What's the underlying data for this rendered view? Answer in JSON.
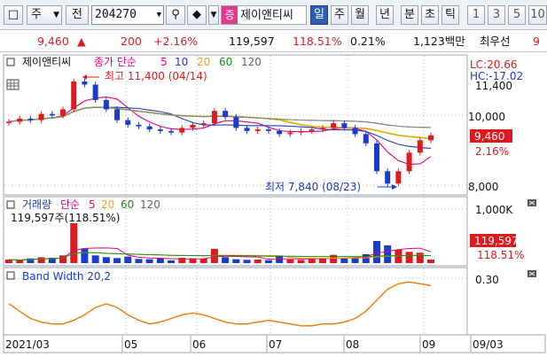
{
  "toolbar": {
    "market": "주",
    "jeon": "전",
    "code": "204270",
    "stock_badge": "증",
    "stock_name": "제이앤티씨",
    "periods": [
      "일",
      "주",
      "월",
      "년",
      "분",
      "초",
      "틱"
    ],
    "active_period": "일",
    "numbers": [
      "1",
      "3",
      "5",
      "10"
    ]
  },
  "quote": {
    "price": "9,460",
    "change_arrow": "▲",
    "change": "200",
    "change_pct": "+2.16%",
    "volume": "119,597",
    "vol_ratio": "118.51%",
    "turnover": "0.21%",
    "amount": "1,123백만",
    "pref_label": "최우선",
    "pref_value": "9"
  },
  "legend": {
    "name": "제이앤티씨",
    "ma_title": "종가 단순",
    "periods": [
      "5",
      "10",
      "20",
      "60",
      "120"
    ],
    "ma_colors": [
      "#e6007e",
      "#1a3bcc",
      "#e6a800",
      "#1b8a1b",
      "#8a8a8a"
    ]
  },
  "volume_legend": {
    "title": "거래량",
    "ma_title": "단순",
    "periods": [
      "5",
      "20",
      "60",
      "120"
    ],
    "value_line": "119,597주(118.51%)"
  },
  "bw_legend": {
    "title": "Band Width 20,2"
  },
  "annotations": {
    "high": "최고 11,400 (04/14)",
    "low": "최저 7,840 (08/23)",
    "lc": "LC:20.66",
    "hc": "HC:-17.02",
    "hc_cut": "11,400"
  },
  "price_axis": {
    "ticks": [
      "10,000",
      "8,000"
    ]
  },
  "current_box": {
    "price": "9,460",
    "pct": "2.16%"
  },
  "volume_axis": {
    "ticks": [
      "1,000K"
    ],
    "current": "119,597",
    "ratio": "118.51%"
  },
  "bw_axis": {
    "ticks": [
      "0.30"
    ]
  },
  "x_axis": {
    "labels": [
      "2021/03",
      "05",
      "06",
      "07",
      "08",
      "09",
      "09/03"
    ]
  },
  "colors": {
    "up": "#e0191e",
    "down": "#1a3bcc",
    "accent": "#2c5fb8"
  },
  "chart_data": [
    {
      "type": "line",
      "title": "",
      "xlabel": "",
      "ylabel": "",
      "series": [
        {
          "name": "종가",
          "values": [
            9900,
            10000,
            9950,
            10150,
            10100,
            10300,
            11200,
            11100,
            10600,
            10300,
            9950,
            9800,
            9750,
            9650,
            9600,
            9550,
            9700,
            9800,
            9850,
            10250,
            10050,
            9700,
            9600,
            9650,
            9600,
            9500,
            9550,
            9600,
            9650,
            9700,
            9850,
            9700,
            9500,
            9200,
            8300,
            7900,
            8300,
            8900,
            9300,
            9460
          ]
        }
      ],
      "ylim": [
        7650,
        11600
      ]
    },
    {
      "type": "bar",
      "title": "",
      "series": [
        {
          "name": "거래량",
          "values": [
            120,
            90,
            160,
            200,
            180,
            260,
            1350,
            500,
            260,
            200,
            170,
            220,
            140,
            130,
            160,
            90,
            180,
            160,
            150,
            480,
            200,
            130,
            110,
            120,
            100,
            260,
            120,
            110,
            130,
            160,
            280,
            160,
            190,
            300,
            750,
            600,
            450,
            380,
            350,
            119.6
          ]
        }
      ],
      "ylim": [
        0,
        1350
      ]
    },
    {
      "type": "line",
      "title": "",
      "series": [
        {
          "name": "Band Width 20,2",
          "values": [
            0.2,
            0.16,
            0.12,
            0.1,
            0.09,
            0.09,
            0.11,
            0.14,
            0.18,
            0.2,
            0.18,
            0.14,
            0.11,
            0.09,
            0.1,
            0.12,
            0.14,
            0.15,
            0.14,
            0.12,
            0.1,
            0.09,
            0.09,
            0.1,
            0.11,
            0.1,
            0.09,
            0.08,
            0.08,
            0.09,
            0.09,
            0.1,
            0.12,
            0.16,
            0.22,
            0.28,
            0.31,
            0.32,
            0.31,
            0.3
          ]
        }
      ],
      "ylim": [
        0.04,
        0.36
      ]
    }
  ]
}
